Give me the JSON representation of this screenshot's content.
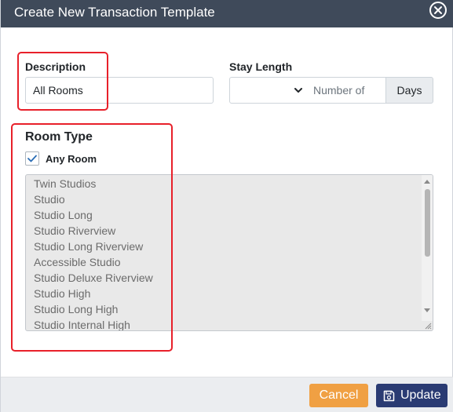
{
  "dialog": {
    "title": "Create New Transaction Template"
  },
  "description": {
    "label": "Description",
    "value": "All Rooms"
  },
  "stay_length": {
    "label": "Stay Length",
    "selected": "",
    "number_placeholder": "Number of",
    "unit_label": "Days"
  },
  "room_type": {
    "title": "Room Type",
    "any_room_label": "Any Room",
    "any_room_checked": true,
    "options": [
      "Twin Studios",
      "Studio",
      "Studio Long",
      "Studio Riverview",
      "Studio Long Riverview",
      "Accessible Studio",
      "Studio Deluxe Riverview",
      "Studio High",
      "Studio Long High",
      "Studio Internal High"
    ]
  },
  "footer": {
    "cancel_label": "Cancel",
    "update_label": "Update"
  },
  "colors": {
    "titlebar": "#3f4a5a",
    "cancel": "#f0a043",
    "update": "#2a3b73",
    "highlight": "#e8202a",
    "check": "#2a6db5"
  },
  "icons": {
    "close": "circle-x-icon",
    "dropdown": "chevron-down-icon",
    "checkbox": "checkmark-icon",
    "update": "save-icon"
  }
}
